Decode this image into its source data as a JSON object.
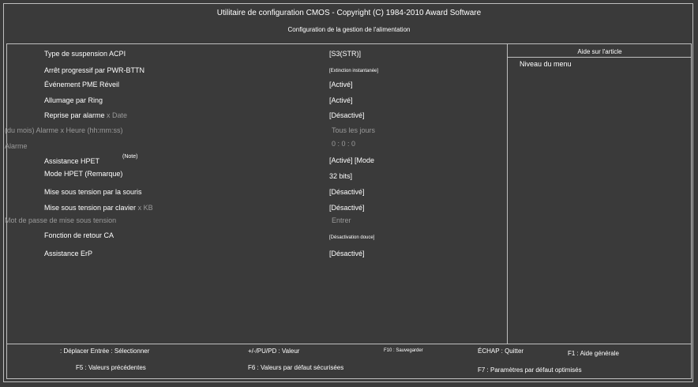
{
  "header": {
    "title": "Utilitaire de configuration CMOS - Copyright (C) 1984-2010 Award Software",
    "subtitle": "Configuration de la gestion de l'alimentation"
  },
  "help": {
    "title": "Aide sur l'article",
    "text": "Niveau du menu"
  },
  "items": {
    "acpi_label": "Type de suspension ACPI",
    "acpi_value": "[S3(STR)]",
    "pwrbttn_label": "Arrêt progressif par PWR-BTTN",
    "pwrbttn_value": "[Extinction instantanée]",
    "pme_label": "Événement PME Réveil",
    "pme_value": "[Activé]",
    "ring_label": "Allumage par Ring",
    "ring_value": "[Activé]",
    "alarm_label": "Reprise par alarme",
    "alarm_suffix": "x Date",
    "alarm_value": "[Désactivé]",
    "alarm_dm_label": "(du mois) Alarme x Heure (hh:mm:ss)",
    "alarm_dm_value": "Tous les jours",
    "alarme_label": "Alarme",
    "alarme_value": "0 : 0 : 0",
    "hpet_label": "Assistance HPET",
    "hpet_note": "(Note)",
    "hpet_value": "[Activé] [Mode",
    "hpet_mode_label": "Mode HPET (Remarque)",
    "hpet_mode_value": "32 bits]",
    "mouse_label": "Mise sous tension par la souris",
    "mouse_value": "[Désactivé]",
    "kb_label": "Mise sous tension par clavier",
    "kb_suffix": "x KB",
    "kb_value": "[Désactivé]",
    "pwd_label": "Mot de passe de mise sous tension",
    "pwd_value": "Entrer",
    "ac_label": "Fonction de retour CA",
    "ac_value": "[Désactivation douce]",
    "erp_label": "Assistance ErP",
    "erp_value": "[Désactivé]"
  },
  "footer": {
    "move": ": Déplacer Entrée : Sélectionner",
    "value": "+/-/PU/PD : Valeur",
    "save": "F10 : Sauvegarder",
    "quit": "ÉCHAP : Quitter",
    "help": "F1 : Aide générale",
    "prev": "F5 : Valeurs précédentes",
    "safe": "F6 : Valeurs par défaut sécurisées",
    "optimized": "F7 : Paramètres par défaut optimisés"
  }
}
